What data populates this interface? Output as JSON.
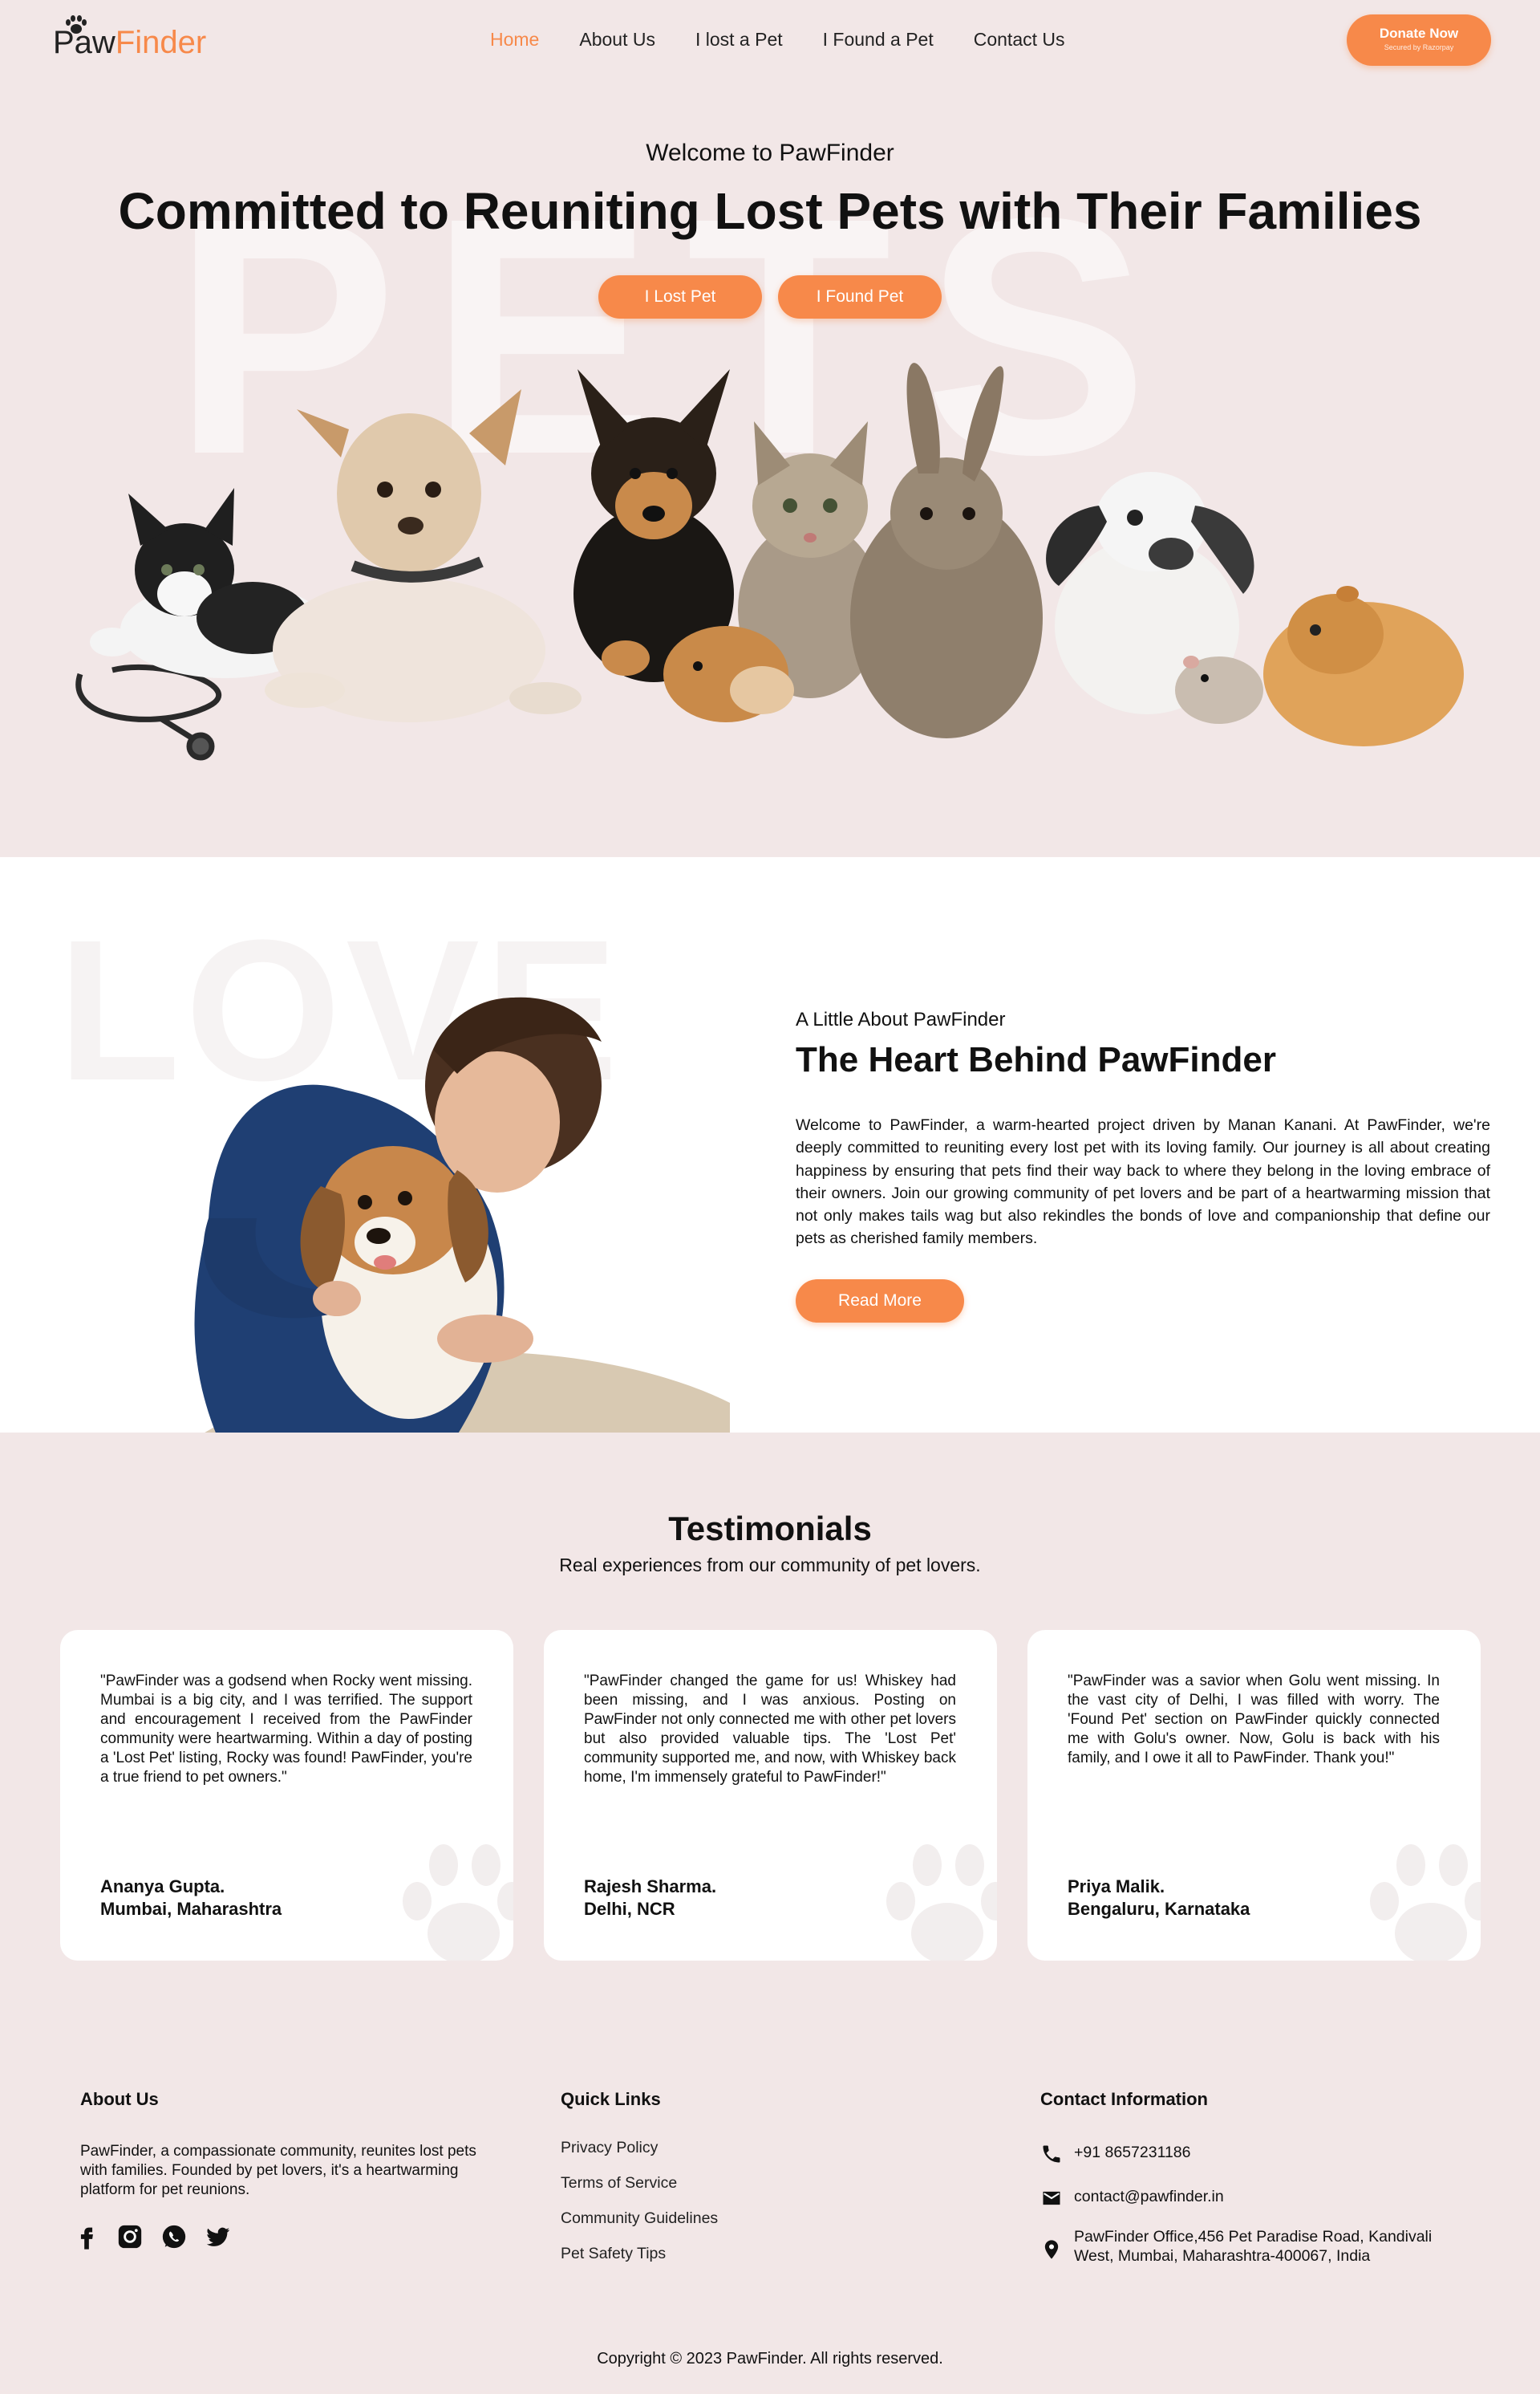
{
  "brand": {
    "name_part1": "Paw",
    "name_part2": "Finder"
  },
  "nav": {
    "items": [
      {
        "label": "Home",
        "active": true
      },
      {
        "label": "About Us",
        "active": false
      },
      {
        "label": "I lost a Pet",
        "active": false
      },
      {
        "label": "I Found a Pet",
        "active": false
      },
      {
        "label": "Contact Us",
        "active": false
      }
    ]
  },
  "donate": {
    "label": "Donate Now",
    "caption": "Secured by Razorpay"
  },
  "hero": {
    "background_word": "PETS",
    "subtitle": "Welcome to PawFinder",
    "title": "Committed to Reuniting Lost Pets with Their Families",
    "btn_lost": "I Lost Pet",
    "btn_found": "I Found Pet"
  },
  "about": {
    "background_word": "LOVE",
    "subtitle": "A Little About PawFinder",
    "title": "The Heart Behind PawFinder",
    "text": "Welcome to PawFinder, a warm-hearted project driven by Manan Kanani. At PawFinder, we're deeply committed to reuniting every lost pet with its loving family. Our journey is all about creating happiness by ensuring that pets find their way back to where they belong in the loving embrace of their owners. Join our growing community of pet lovers and be part of a heartwarming mission that not only makes tails wag but also rekindles the bonds of love and companionship that define our pets as cherished family members.",
    "button": "Read More"
  },
  "testimonials": {
    "title": "Testimonials",
    "subtitle": "Real experiences from our community of pet lovers.",
    "items": [
      {
        "quote": "\"PawFinder was a godsend when Rocky went missing. Mumbai is a big city, and I was terrified. The support and encouragement I received from the PawFinder community were heartwarming. Within a day of posting a 'Lost Pet' listing, Rocky was found! PawFinder, you're a true friend to pet owners.\"",
        "name": "Ananya Gupta.",
        "location": "Mumbai, Maharashtra"
      },
      {
        "quote": "\"PawFinder changed the game for us! Whiskey had been missing, and I was anxious. Posting on PawFinder not only connected me with other pet lovers but also provided valuable tips. The 'Lost Pet' community supported me, and now, with Whiskey back home, I'm immensely grateful to PawFinder!\"",
        "name": "Rajesh Sharma.",
        "location": "Delhi, NCR"
      },
      {
        "quote": "\"PawFinder was a savior when Golu went missing. In the vast city of Delhi, I was filled with worry. The 'Found Pet' section on PawFinder quickly connected me with Golu's owner. Now, Golu is back with his family, and I owe it all to PawFinder. Thank you!\"",
        "name": "Priya Malik.",
        "location": "Bengaluru, Karnataka"
      }
    ]
  },
  "footer": {
    "about_title": "About Us",
    "about_text": "PawFinder, a compassionate community, reunites lost pets with families. Founded by pet lovers, it's a heartwarming platform for pet reunions.",
    "socials": [
      "facebook-icon",
      "instagram-icon",
      "whatsapp-icon",
      "twitter-icon"
    ],
    "links_title": "Quick Links",
    "links": [
      "Privacy Policy",
      "Terms of Service",
      "Community Guidelines",
      "Pet Safety Tips"
    ],
    "contact_title": "Contact Information",
    "phone": "+91 8657231186",
    "email": "contact@pawfinder.in",
    "address": "PawFinder Office,456 Pet Paradise Road, Kandivali West, Mumbai, Maharashtra-400067, India",
    "copyright": "Copyright © 2023 PawFinder. All rights reserved."
  },
  "colors": {
    "accent": "#f7894a",
    "background": "#f2e7e7",
    "card": "#ffffff",
    "text": "#111111"
  }
}
